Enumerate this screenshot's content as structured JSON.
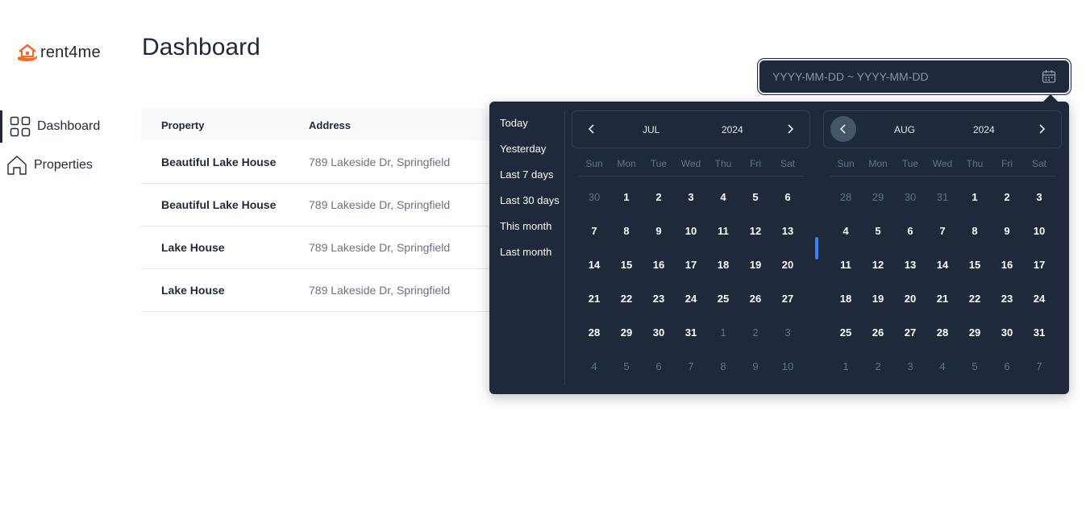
{
  "brand": {
    "name": "rent4me"
  },
  "sidebar": {
    "items": [
      {
        "label": "Dashboard",
        "icon": "grid-icon",
        "active": true
      },
      {
        "label": "Properties",
        "icon": "home-icon",
        "active": false
      }
    ]
  },
  "header": {
    "title": "Dashboard"
  },
  "date_range": {
    "placeholder": "YYYY-MM-DD ~ YYYY-MM-DD",
    "icon": "calendar-icon"
  },
  "table": {
    "columns": [
      "Property",
      "Address"
    ],
    "rows": [
      {
        "property": "Beautiful Lake House",
        "address": "789 Lakeside Dr, Springfield"
      },
      {
        "property": "Beautiful Lake House",
        "address": "789 Lakeside Dr, Springfield"
      },
      {
        "property": "Lake House",
        "address": "789 Lakeside Dr, Springfield"
      },
      {
        "property": "Lake House",
        "address": "789 Lakeside Dr, Springfield"
      }
    ]
  },
  "picker": {
    "presets": [
      "Today",
      "Yesterday",
      "Last 7 days",
      "Last 30 days",
      "This month",
      "Last month"
    ],
    "weekdays": [
      "Sun",
      "Mon",
      "Tue",
      "Wed",
      "Thu",
      "Fri",
      "Sat"
    ],
    "calendars": [
      {
        "month": "JUL",
        "year": "2024",
        "days": [
          {
            "d": "30",
            "m": true
          },
          {
            "d": "1"
          },
          {
            "d": "2"
          },
          {
            "d": "3"
          },
          {
            "d": "4"
          },
          {
            "d": "5"
          },
          {
            "d": "6"
          },
          {
            "d": "7"
          },
          {
            "d": "8"
          },
          {
            "d": "9"
          },
          {
            "d": "10"
          },
          {
            "d": "11"
          },
          {
            "d": "12"
          },
          {
            "d": "13"
          },
          {
            "d": "14"
          },
          {
            "d": "15"
          },
          {
            "d": "16"
          },
          {
            "d": "17"
          },
          {
            "d": "18"
          },
          {
            "d": "19"
          },
          {
            "d": "20"
          },
          {
            "d": "21"
          },
          {
            "d": "22"
          },
          {
            "d": "23"
          },
          {
            "d": "24"
          },
          {
            "d": "25"
          },
          {
            "d": "26"
          },
          {
            "d": "27"
          },
          {
            "d": "28"
          },
          {
            "d": "29"
          },
          {
            "d": "30"
          },
          {
            "d": "31"
          },
          {
            "d": "1",
            "m": true
          },
          {
            "d": "2",
            "m": true
          },
          {
            "d": "3",
            "m": true
          },
          {
            "d": "4",
            "m": true
          },
          {
            "d": "5",
            "m": true
          },
          {
            "d": "6",
            "m": true
          },
          {
            "d": "7",
            "m": true
          },
          {
            "d": "8",
            "m": true
          },
          {
            "d": "9",
            "m": true
          },
          {
            "d": "10",
            "m": true
          }
        ]
      },
      {
        "month": "AUG",
        "year": "2024",
        "days": [
          {
            "d": "28",
            "m": true
          },
          {
            "d": "29",
            "m": true
          },
          {
            "d": "30",
            "m": true
          },
          {
            "d": "31",
            "m": true
          },
          {
            "d": "1"
          },
          {
            "d": "2"
          },
          {
            "d": "3"
          },
          {
            "d": "4"
          },
          {
            "d": "5"
          },
          {
            "d": "6"
          },
          {
            "d": "7"
          },
          {
            "d": "8"
          },
          {
            "d": "9"
          },
          {
            "d": "10"
          },
          {
            "d": "11"
          },
          {
            "d": "12"
          },
          {
            "d": "13"
          },
          {
            "d": "14"
          },
          {
            "d": "15"
          },
          {
            "d": "16"
          },
          {
            "d": "17"
          },
          {
            "d": "18"
          },
          {
            "d": "19"
          },
          {
            "d": "20"
          },
          {
            "d": "21"
          },
          {
            "d": "22"
          },
          {
            "d": "23"
          },
          {
            "d": "24"
          },
          {
            "d": "25"
          },
          {
            "d": "26"
          },
          {
            "d": "27"
          },
          {
            "d": "28"
          },
          {
            "d": "29"
          },
          {
            "d": "30"
          },
          {
            "d": "31"
          },
          {
            "d": "1",
            "m": true
          },
          {
            "d": "2",
            "m": true
          },
          {
            "d": "3",
            "m": true
          },
          {
            "d": "4",
            "m": true
          },
          {
            "d": "5",
            "m": true
          },
          {
            "d": "6",
            "m": true
          },
          {
            "d": "7",
            "m": true
          }
        ]
      }
    ]
  },
  "colors": {
    "brand_accent": "#f26b2b",
    "popup_bg": "#1e293b",
    "scroll_accent": "#3b82f6"
  }
}
